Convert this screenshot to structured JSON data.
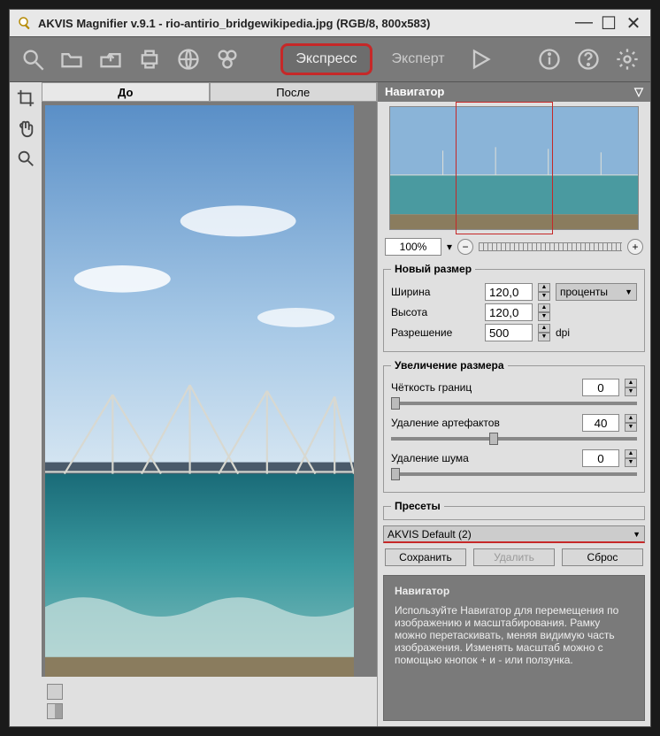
{
  "window": {
    "title": "AKVIS Magnifier v.9.1 - rio-antirio_bridgewikipedia.jpg (RGB/8, 800x583)"
  },
  "titlebar_controls": {
    "min": "—",
    "max": "☐",
    "close": "✕"
  },
  "toolbar_icons": {
    "logo": "magnifier-icon",
    "open": "open-icon",
    "save": "save-icon",
    "print": "print-icon",
    "web": "web-icon",
    "settings": "gear-icon"
  },
  "modes": {
    "express": "Экспресс",
    "expert": "Эксперт"
  },
  "right_icons": {
    "run": "play-icon",
    "info": "info-icon",
    "help": "help-icon",
    "prefs": "gear-icon"
  },
  "view_tabs": {
    "before": "До",
    "after": "После"
  },
  "panel": {
    "navigator_title": "Навигатор",
    "zoom_value": "100%",
    "zoom_spinner": "▾"
  },
  "newsize": {
    "legend": "Новый размер",
    "width_lbl": "Ширина",
    "width_val": "120,0",
    "height_lbl": "Высота",
    "height_val": "120,0",
    "res_lbl": "Разрешение",
    "res_val": "500",
    "unit": "проценты",
    "res_unit": "dpi"
  },
  "enlarge": {
    "legend": "Увеличение размера",
    "sharp_lbl": "Чёткость границ",
    "sharp_val": "0",
    "artifact_lbl": "Удаление артефактов",
    "artifact_val": "40",
    "noise_lbl": "Удаление шума",
    "noise_val": "0"
  },
  "presets": {
    "legend": "Пресеты",
    "value": "AKVIS Default (2)",
    "save": "Сохранить",
    "delete": "Удалить",
    "reset": "Сброс"
  },
  "hints": {
    "title": "Навигатор",
    "body": "Используйте Навигатор для перемещения по изображению и масштабирования. Рамку можно перетаскивать, меняя видимую часть изображения. Изменять масштаб можно с помощью кнопок + и - или ползунка."
  }
}
